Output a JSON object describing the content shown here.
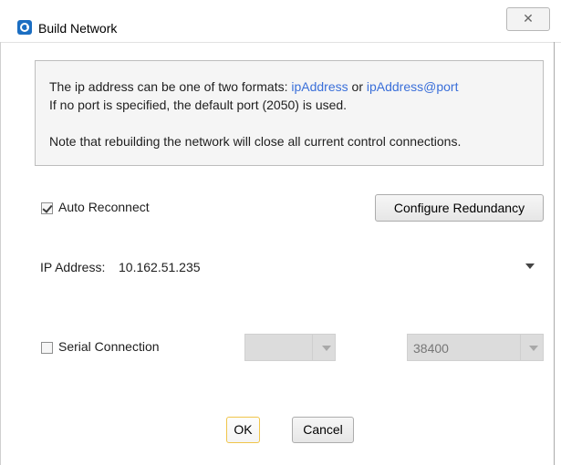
{
  "window": {
    "title": "Build Network",
    "close_glyph": "✕"
  },
  "info": {
    "line1_prefix": "The ip address can be one of two formats: ",
    "format1": "ipAddress",
    "or": " or ",
    "format2": "ipAddress@port",
    "line2": "If no port is specified, the default port (2050) is used.",
    "line3": "Note that rebuilding the network will close all current control connections."
  },
  "auto_reconnect": {
    "label": "Auto Reconnect",
    "checked": true
  },
  "configure_redundancy": {
    "label": "Configure Redundancy"
  },
  "ip_address": {
    "label": "IP Address:",
    "value": "10.162.51.235"
  },
  "serial_connection": {
    "label": "Serial Connection",
    "checked": false,
    "port_value": "",
    "baud_value": "38400"
  },
  "buttons": {
    "ok": "OK",
    "cancel": "Cancel"
  },
  "colors": {
    "link": "#3a6fd9",
    "ok_border": "#f0c54a",
    "app_icon": "#1b6ec2"
  },
  "icons": {
    "app": "app-logo-icon",
    "close": "close-icon",
    "dropdown": "chevron-down-icon",
    "check": "checkmark-icon"
  }
}
